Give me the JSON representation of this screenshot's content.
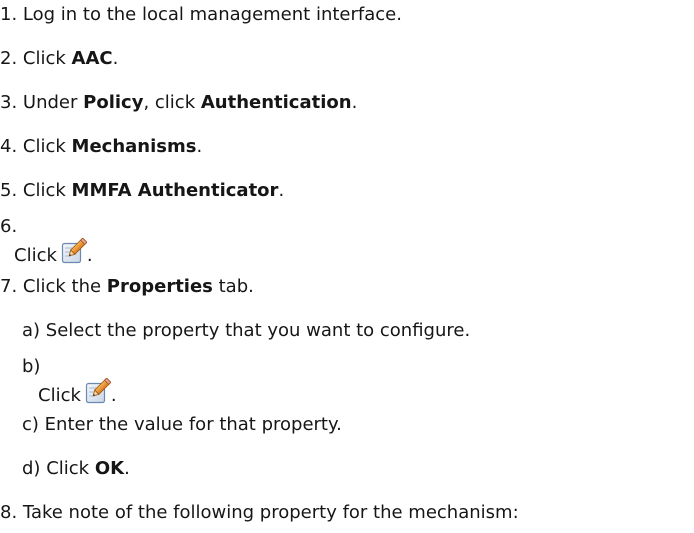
{
  "steps": [
    {
      "num": "1.",
      "text": "Log in to the local management interface."
    },
    {
      "num": "2.",
      "pre": "Click ",
      "bold": "AAC",
      "post": "."
    },
    {
      "num": "3.",
      "pre": "Under ",
      "bold": "Policy",
      "mid": ", click ",
      "bold2": "Authentication",
      "post": "."
    },
    {
      "num": "4.",
      "pre": "Click ",
      "bold": "Mechanisms",
      "post": "."
    },
    {
      "num": "5.",
      "pre": "Click ",
      "bold": "MMFA Authenticator",
      "post": "."
    },
    {
      "num": "6.",
      "pre": "Click",
      "post": ".",
      "icon": "edit-icon"
    },
    {
      "num": "7.",
      "pre": "Click the ",
      "bold": "Properties",
      "post": " tab."
    },
    {
      "num": "8.",
      "text": "Take note of the following property for the mechanism:"
    }
  ],
  "substeps": [
    {
      "label": "a)",
      "text": "Select the property that you want to configure."
    },
    {
      "label": "b)",
      "pre": "Click",
      "post": ".",
      "icon": "edit-icon"
    },
    {
      "label": "c)",
      "text": "Enter the value for that property."
    },
    {
      "label": "d)",
      "pre": "Click ",
      "bold": "OK",
      "post": "."
    }
  ]
}
